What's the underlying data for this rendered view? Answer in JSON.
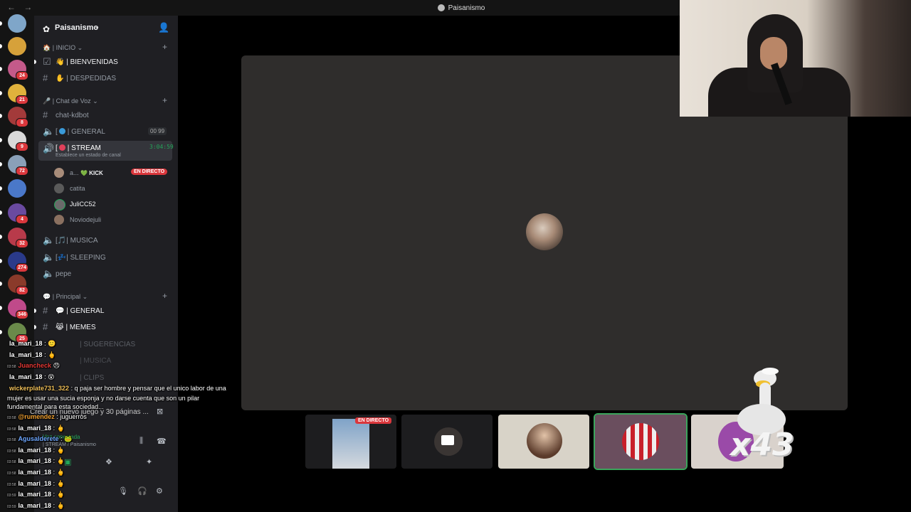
{
  "titlebar": {
    "title": "Paisanismo",
    "nav": "← →"
  },
  "guild_rail": {
    "guilds": [
      {
        "badge": "",
        "color": "#7fa6c9"
      },
      {
        "badge": "",
        "color": "#d6a13a"
      },
      {
        "badge": "24",
        "color": "#c45a8a"
      },
      {
        "badge": "21",
        "color": "#e0b23c"
      },
      {
        "badge": "8",
        "color": "#a33a3a"
      },
      {
        "badge": "9",
        "color": "#d9d9d9"
      },
      {
        "badge": "72",
        "color": "#8aa0b8"
      },
      {
        "badge": "",
        "color": "#4a78c9"
      },
      {
        "badge": "4",
        "color": "#6a4aa0"
      },
      {
        "badge": "32",
        "color": "#b83a4a"
      },
      {
        "badge": "274",
        "color": "#2a3a8a"
      },
      {
        "badge": "82",
        "color": "#8a3a2a"
      },
      {
        "badge": "346",
        "color": "#c04a8a"
      },
      {
        "badge": "25",
        "color": "#6a8a4a"
      }
    ]
  },
  "sidebar": {
    "server_name": "Paisanismo",
    "categories": {
      "inicio": "| INICIO",
      "voz": "| Chat de Voz",
      "principal": "| Principal"
    },
    "channels": {
      "bienvenidas": "| BIENVENIDAS",
      "despedidas": "| DESPEDIDAS",
      "chat_kdbot": "chat-kdbot",
      "general_voice": "| GENERAL",
      "general_voice_count": "00 99",
      "stream": "| STREAM",
      "stream_timer": "3:04:59",
      "stream_status": "Establece un estado de canal",
      "musica": "| MUSICA",
      "sleeping": "| SLEEPING",
      "pepe": "pepe",
      "general_text": "| GENERAL",
      "memes": "| MEMES",
      "sugerencias": "| SUGERENCIAS",
      "musica_text": "| MUSICA",
      "clips": "| CLIPS"
    },
    "voice_users": [
      {
        "name": "a...",
        "extra": "💚 KICK",
        "live": "EN DIRECTO"
      },
      {
        "name": "catita"
      },
      {
        "name": "JuliCC52"
      },
      {
        "name": "Noviodejuli"
      }
    ],
    "panel": {
      "create_game": "Crear un nuevo juego y 30 páginas ...",
      "voice_connected": "Voz conectada",
      "voice_channel": "| STREAM / Paisanismo"
    }
  },
  "stage": {
    "thumb_live": "EN DIRECTO"
  },
  "chat": [
    {
      "ts": "",
      "user": "la_mari_18",
      "msg": ": 🙂",
      "color": "#ffffff"
    },
    {
      "ts": "",
      "user": "la_mari_18",
      "msg": ": 🖕",
      "color": "#ffffff"
    },
    {
      "ts": "03:58",
      "user": "Juancheck",
      "msg": "😠",
      "color": "#e53935"
    },
    {
      "ts": "",
      "user": "la_mari_18",
      "msg": ": 😵",
      "color": "#ffffff"
    },
    {
      "ts": "",
      "user": "wickerplate731_322",
      "msg": ": q paja ser hombre y pensar que el unico labor de una mujer es usar una sucia esponja y no darse cuenta que son un pilar fundamental para esta sociedad...",
      "color": "#f0c05a"
    },
    {
      "ts": "03:58",
      "user": "@rumendez",
      "msg": ": juguerros",
      "color": "#f0a030"
    },
    {
      "ts": "03:58",
      "user": "la_mari_18",
      "msg": ": 🖕",
      "color": "#ffffff"
    },
    {
      "ts": "03:58",
      "user": "Agusalderete",
      "msg": ": 🐸",
      "color": "#6fa8ff"
    },
    {
      "ts": "03:58",
      "user": "la_mari_18",
      "msg": ": 🖕",
      "color": "#ffffff"
    },
    {
      "ts": "03:58",
      "user": "la_mari_18",
      "msg": ": 🖕",
      "color": "#ffffff"
    },
    {
      "ts": "03:58",
      "user": "la_mari_18",
      "msg": ": 🖕",
      "color": "#ffffff"
    },
    {
      "ts": "03:58",
      "user": "la_mari_18",
      "msg": ": 🖕",
      "color": "#ffffff"
    },
    {
      "ts": "03:59",
      "user": "la_mari_18",
      "msg": ": 🖕",
      "color": "#ffffff"
    },
    {
      "ts": "03:59",
      "user": "la_mari_18",
      "msg": ": 🖕",
      "color": "#ffffff"
    }
  ],
  "overlay": {
    "multiplier": "x43"
  },
  "colors": {
    "accent_green": "#23a559",
    "live_red": "#da373c"
  }
}
